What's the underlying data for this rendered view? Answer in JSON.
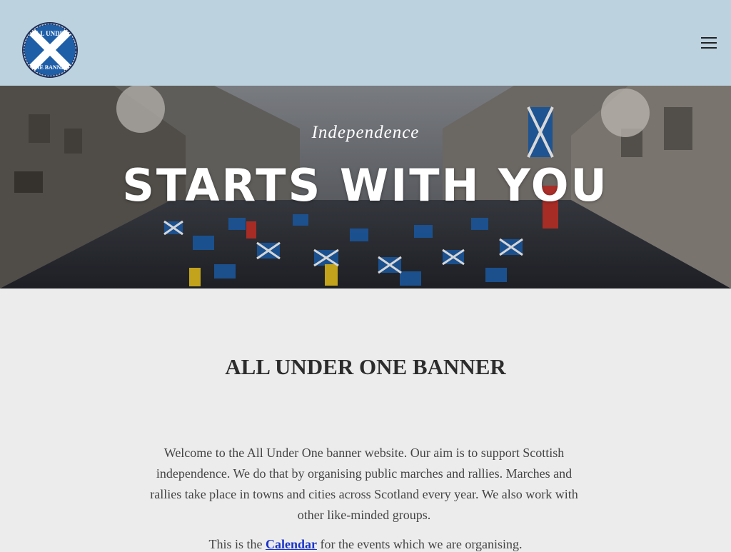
{
  "header": {
    "logo_text_top": "ALL UNDER",
    "logo_text_bottom": "ONE BANNER",
    "menu_icon": "hamburger-menu-icon"
  },
  "hero": {
    "subtitle": "Independence",
    "title": "STARTS WITH YOU",
    "background": "photo of a march with Scottish saltire flags"
  },
  "main": {
    "heading": "ALL UNDER ONE BANNER",
    "intro": "Welcome to the All Under One banner website. Our aim is to support Scottish independence. We do that by organising public marches and rallies. Marches and rallies take place in towns and cities across Scotland every year. We also work with other like-minded groups.",
    "calendar_prefix": "This is the ",
    "calendar_link": "Calendar",
    "calendar_suffix": " for the events which we are organising."
  },
  "colors": {
    "header_bg": "#bcd2df",
    "page_bg": "#ececec",
    "link": "#1a33c9",
    "saltire_blue": "#1f5fa8"
  }
}
